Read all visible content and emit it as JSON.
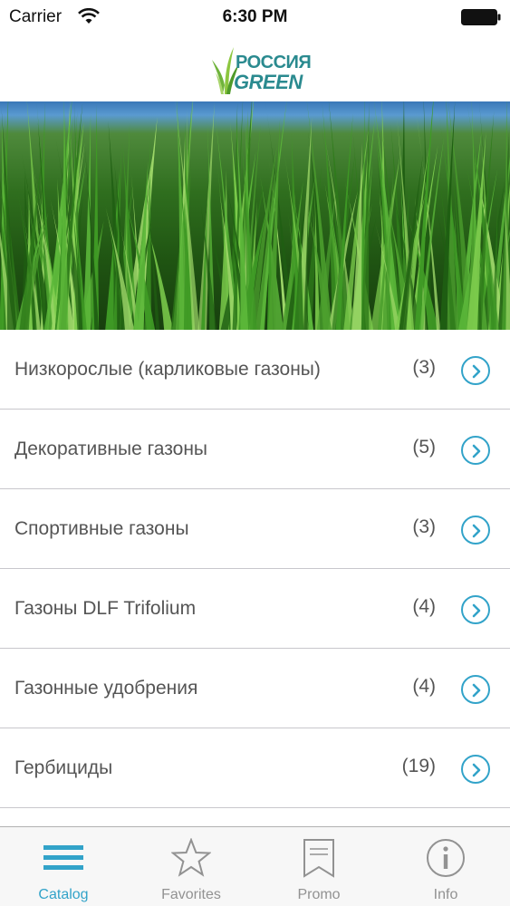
{
  "status_bar": {
    "carrier": "Carrier",
    "time": "6:30 PM",
    "icons": [
      "wifi-icon",
      "battery-icon"
    ]
  },
  "header": {
    "logo_line1": "РОССИЯ",
    "logo_line2": "GREEN",
    "logo_color": "#2a8a8f"
  },
  "catalog": {
    "items": [
      {
        "label": "Низкорослые (карликовые газоны)",
        "count": "(3)"
      },
      {
        "label": "Декоративные газоны",
        "count": "(5)"
      },
      {
        "label": "Спортивные газоны",
        "count": "(3)"
      },
      {
        "label": "Газоны DLF Trifolium",
        "count": "(4)"
      },
      {
        "label": "Газонные удобрения",
        "count": "(4)"
      },
      {
        "label": "Гербициды",
        "count": "(19)"
      }
    ],
    "chevron_icon": "chevron-right-circle-icon",
    "accent": "#32a3c9"
  },
  "tabbar": {
    "tabs": [
      {
        "label": "Catalog",
        "icon": "list-icon",
        "active": true
      },
      {
        "label": "Favorites",
        "icon": "star-icon",
        "active": false
      },
      {
        "label": "Promo",
        "icon": "bookmark-icon",
        "active": false
      },
      {
        "label": "Info",
        "icon": "info-icon",
        "active": false
      }
    ],
    "active_color": "#32a3c9",
    "inactive_color": "#929292"
  }
}
